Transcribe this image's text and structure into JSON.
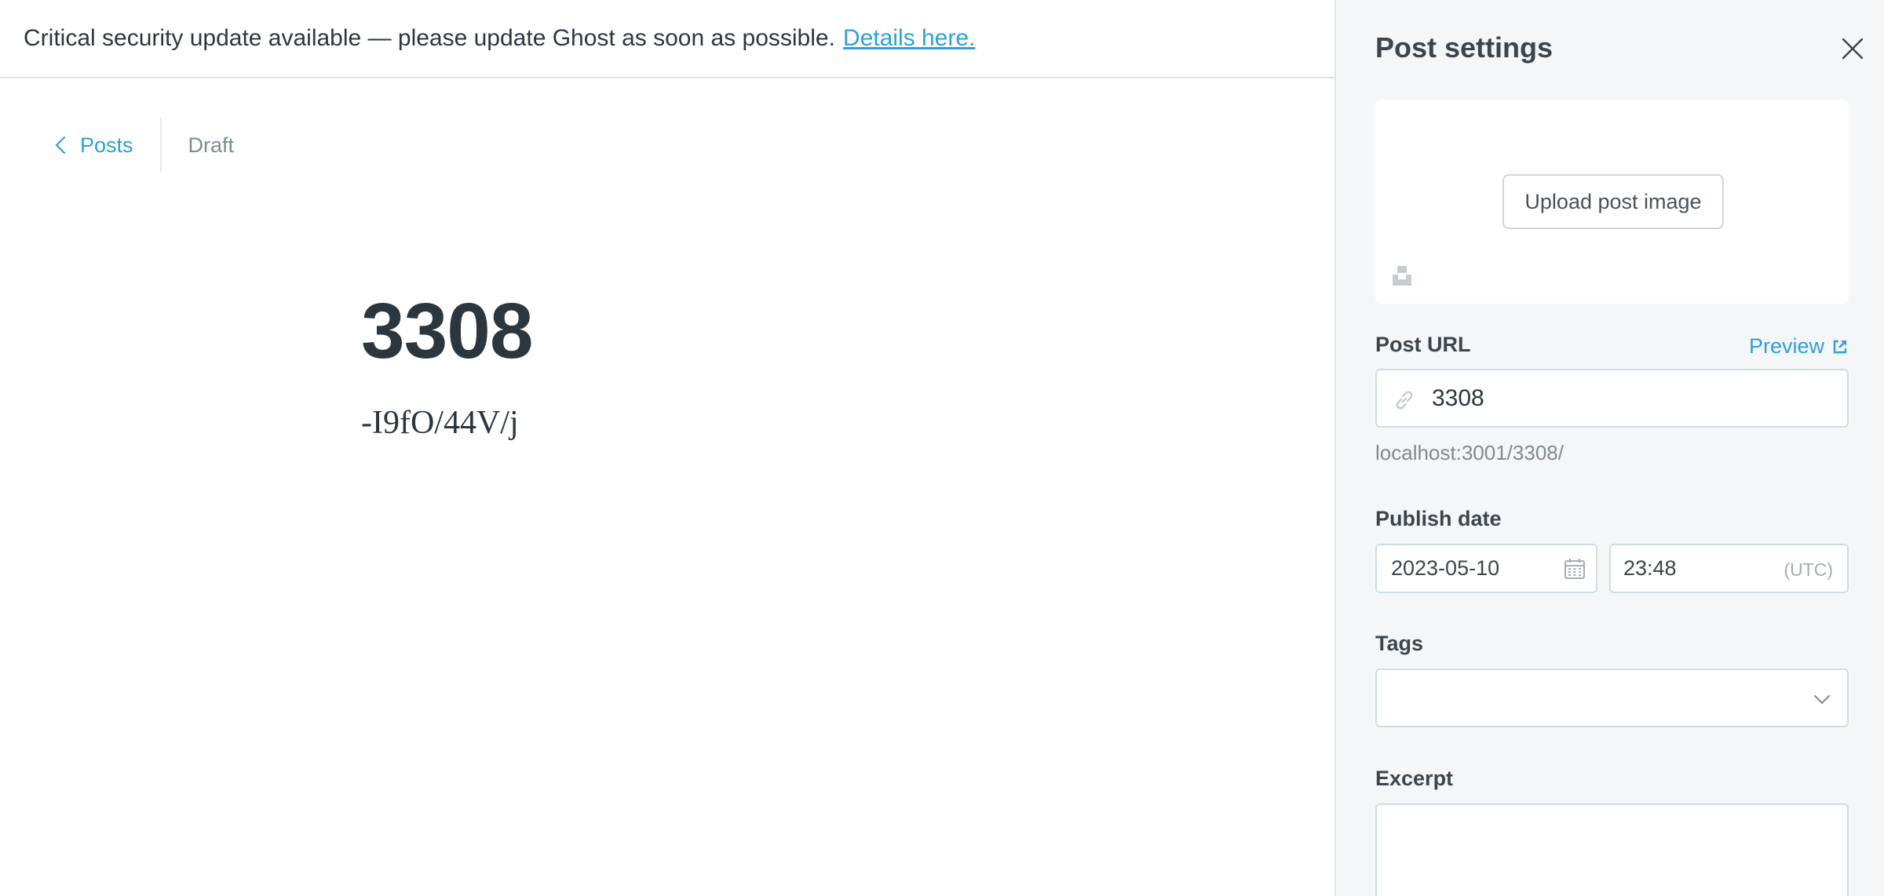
{
  "alert": {
    "message": "Critical security update available — please update Ghost as soon as possible.",
    "link_text": "Details here."
  },
  "editor": {
    "back_label": "Posts",
    "status": "Draft",
    "title": "3308",
    "body": "-I9fO/44V/j"
  },
  "settings": {
    "title": "Post settings",
    "upload_label": "Upload post image",
    "url": {
      "label": "Post URL",
      "preview_label": "Preview",
      "value": "3308",
      "hint": "localhost:3001/3308/"
    },
    "publish": {
      "label": "Publish date",
      "date": "2023-05-10",
      "time": "23:48",
      "timezone": "(UTC)"
    },
    "tags": {
      "label": "Tags",
      "value": ""
    },
    "excerpt": {
      "label": "Excerpt",
      "value": ""
    }
  },
  "colors": {
    "accent": "#2ea0d9",
    "panel_bg": "#f4f6f8",
    "text_dark": "#2b363e",
    "text_muted": "#7d8b95"
  },
  "icons": [
    "chevron-left-icon",
    "close-icon",
    "unsplash-icon",
    "external-link-icon",
    "link-icon",
    "calendar-icon",
    "chevron-down-icon"
  ]
}
